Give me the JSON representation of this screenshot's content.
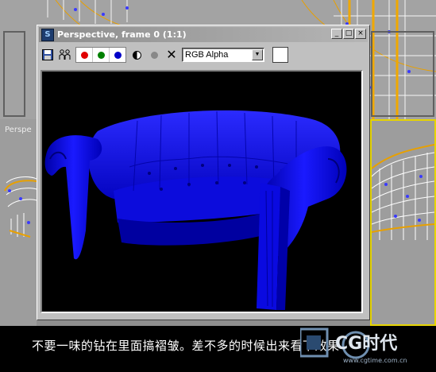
{
  "viewport": {
    "label": "Perspe"
  },
  "render_window": {
    "title": "Perspective, frame 0 (1:1)",
    "minimize": "_",
    "restore": "□",
    "close": "×",
    "channel_select": "RGB Alpha",
    "channel_options": [
      "RGB Alpha"
    ],
    "colors": {
      "red": "#e00000",
      "green": "#008000",
      "blue": "#0000c8",
      "sofa": "#0a0af0"
    }
  },
  "subtitle": "不要一味的钻在里面搞褶皱。差不多的时候出来看下效果",
  "watermark": {
    "brand": "CG时代",
    "url": "www.cgtime.com.cn"
  }
}
